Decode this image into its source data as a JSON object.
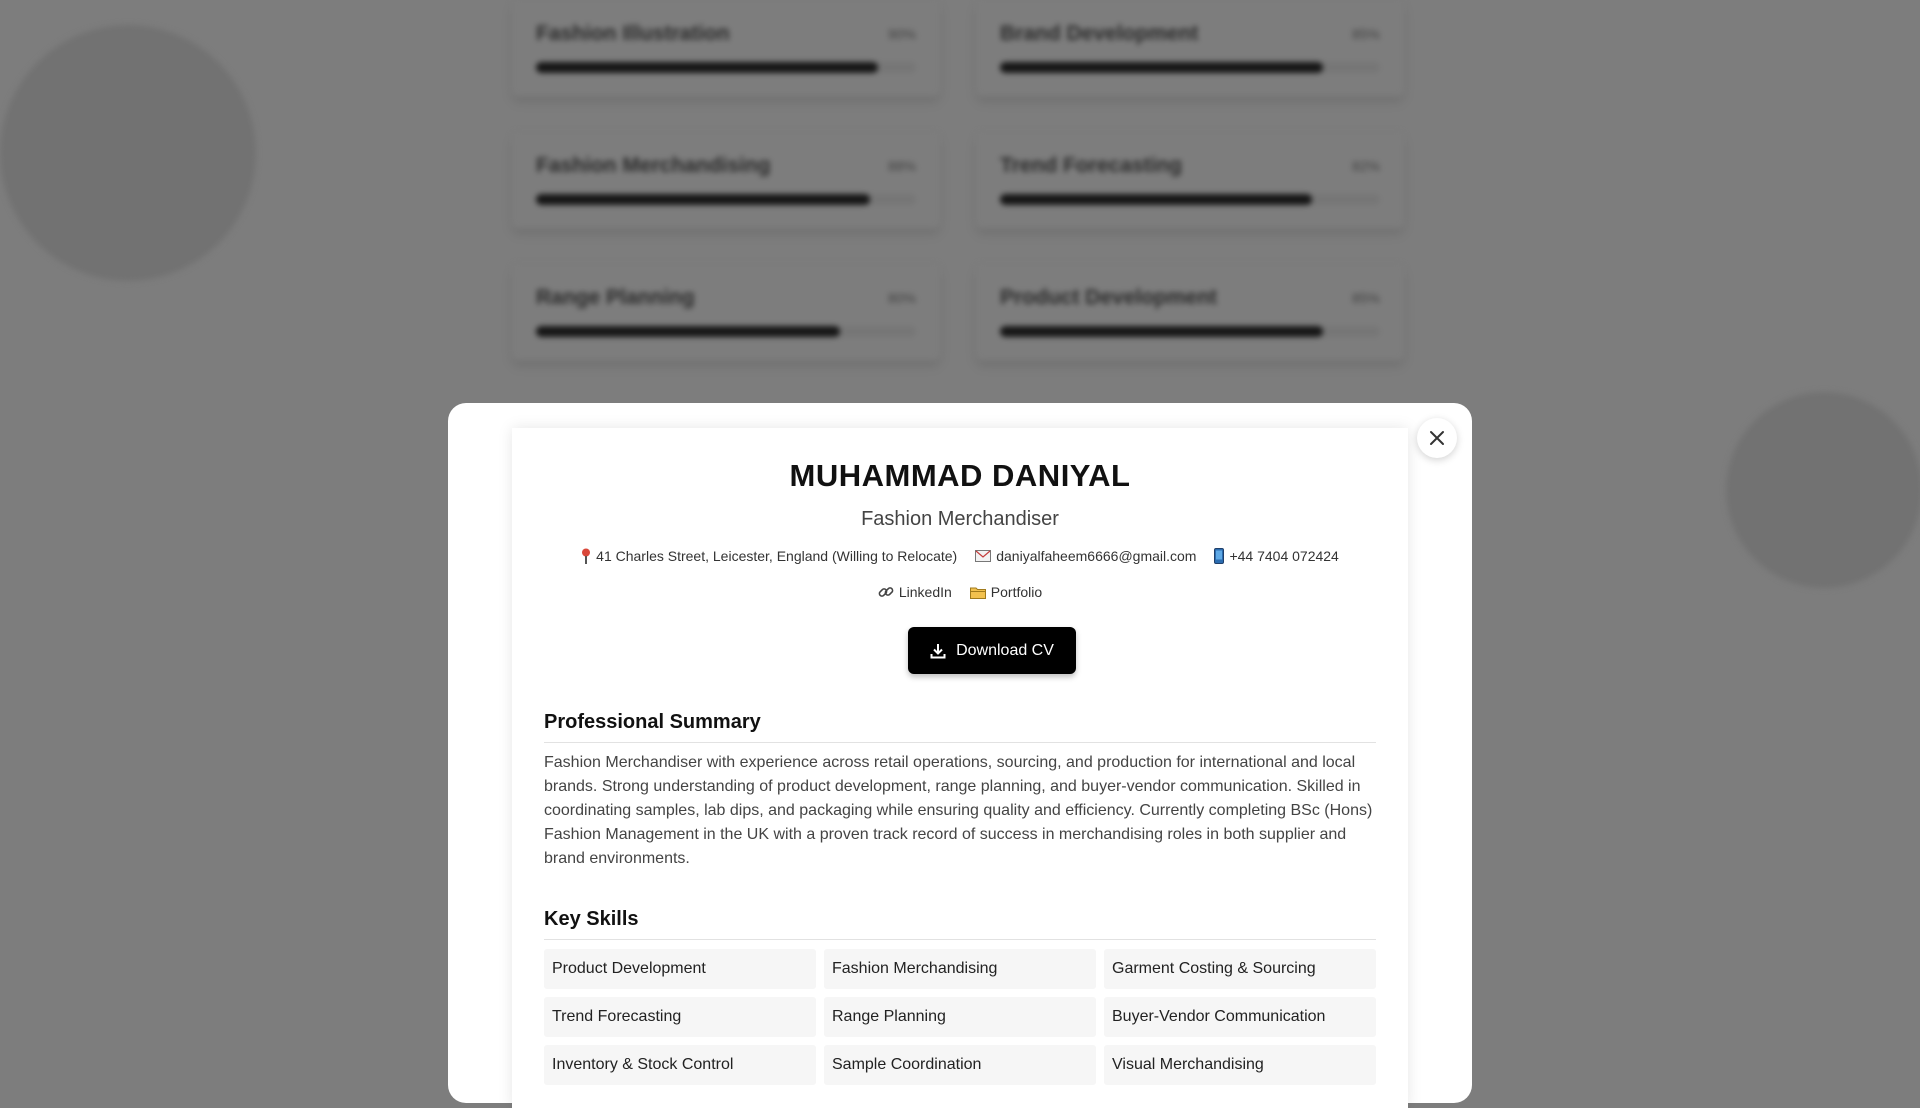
{
  "background": {
    "skills": [
      {
        "name": "Fashion Illustration",
        "percent": "90%",
        "level": 0.9
      },
      {
        "name": "Brand Development",
        "percent": "85%",
        "level": 0.85
      },
      {
        "name": "Fashion Merchandising",
        "percent": "88%",
        "level": 0.88
      },
      {
        "name": "Trend Forecasting",
        "percent": "82%",
        "level": 0.82
      },
      {
        "name": "Range Planning",
        "percent": "80%",
        "level": 0.8
      },
      {
        "name": "Product Development",
        "percent": "85%",
        "level": 0.85
      }
    ]
  },
  "modal": {
    "close_icon": "close-icon",
    "name": "MUHAMMAD DANIYAL",
    "role": "Fashion Merchandiser",
    "contact": {
      "address": "41 Charles Street, Leicester, England (Willing to Relocate)",
      "email": "daniyalfaheem6666@gmail.com",
      "phone": "+44 7404 072424",
      "linkedin": "LinkedIn",
      "portfolio": "Portfolio"
    },
    "download_label": "Download CV",
    "summary_title": "Professional Summary",
    "summary_text": "Fashion Merchandiser with experience across retail operations, sourcing, and production for international and local brands. Strong understanding of product development, range planning, and buyer-vendor communication. Skilled in coordinating samples, lab dips, and packaging while ensuring quality and efficiency. Currently completing BSc (Hons) Fashion Management in the UK with a proven track record of success in merchandising roles in both supplier and brand environments.",
    "skills_title": "Key Skills",
    "skills": [
      "Product Development",
      "Fashion Merchandising",
      "Garment Costing & Sourcing",
      "Trend Forecasting",
      "Range Planning",
      "Buyer-Vendor Communication",
      "Inventory & Stock Control",
      "Sample Coordination",
      "Visual Merchandising"
    ]
  },
  "colors": {
    "overlay": "#7d7d7d",
    "button_bg": "#000000",
    "chip_bg": "#f6f6f6"
  }
}
